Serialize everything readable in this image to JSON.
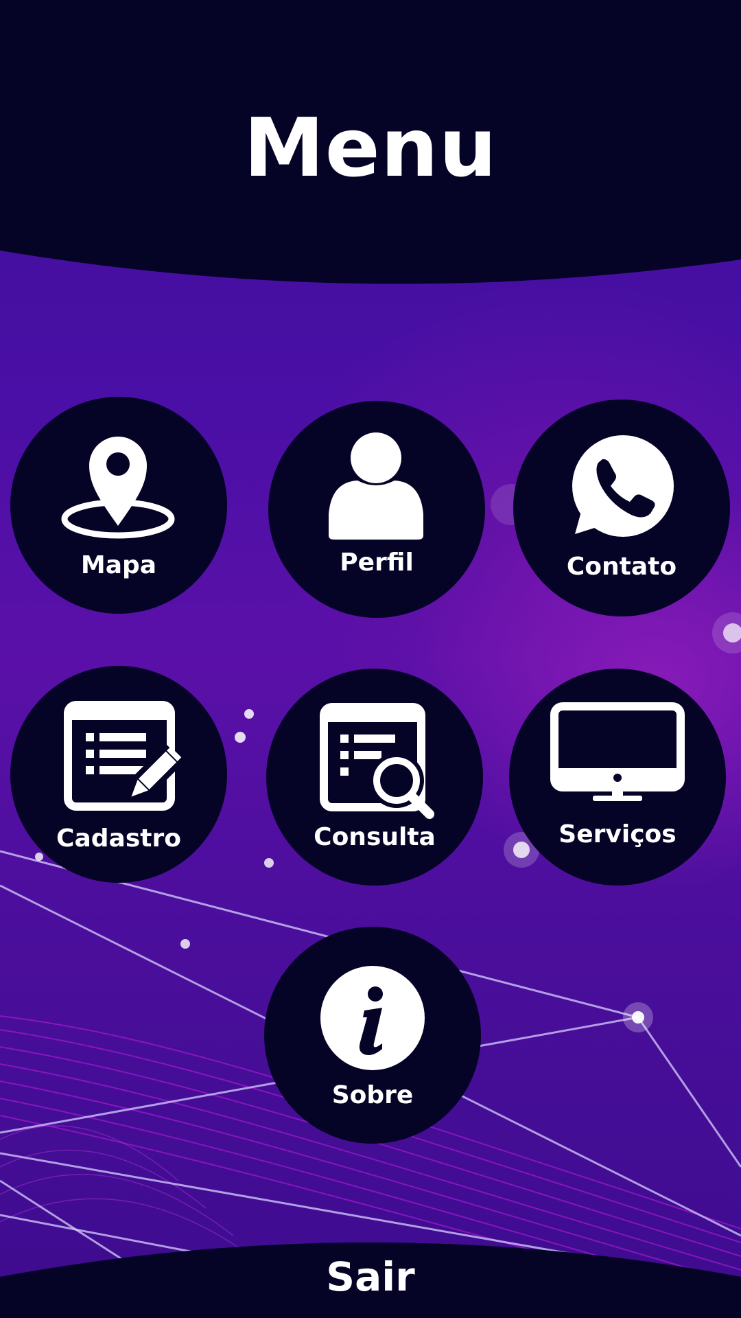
{
  "header": {
    "title": "Menu"
  },
  "colors": {
    "tile_bg": "#050326",
    "header_bg": "#050326",
    "bg_purple": "#4a0fa6",
    "text": "#ffffff",
    "accent_magenta": "#c020e0"
  },
  "menu": {
    "items": [
      {
        "label": "Mapa",
        "icon": "map-pin-icon"
      },
      {
        "label": "Perfil",
        "icon": "user-icon"
      },
      {
        "label": "Contato",
        "icon": "whatsapp-phone-icon"
      },
      {
        "label": "Cadastro",
        "icon": "form-edit-icon"
      },
      {
        "label": "Consulta",
        "icon": "form-search-icon"
      },
      {
        "label": "Serviços",
        "icon": "monitor-icon"
      },
      {
        "label": "Sobre",
        "icon": "info-icon"
      }
    ]
  },
  "footer": {
    "exit_label": "Sair"
  }
}
